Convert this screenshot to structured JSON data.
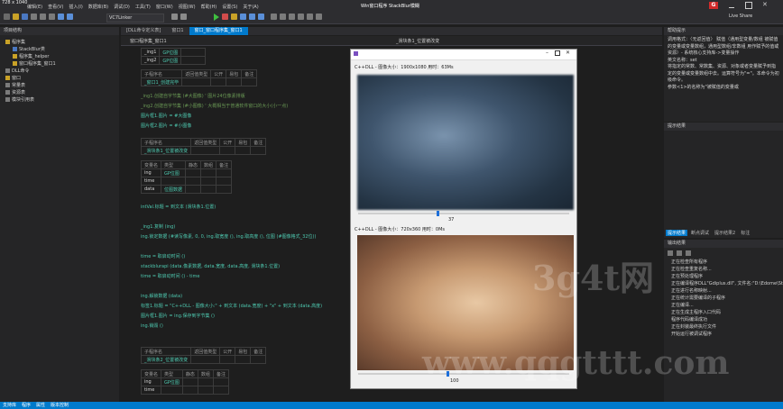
{
  "window": {
    "size_label": "728 x 1040",
    "title": "Win窗口程序 StackBlur模糊",
    "live_share": "Live Share",
    "logo_letter": "G"
  },
  "menu": [
    "编辑(E)",
    "查看(V)",
    "插入(I)",
    "数据库(B)",
    "调试(D)",
    "工具(T)",
    "窗口(W)",
    "视图(W)",
    "帮助(H)",
    "设置(S)",
    "关于(A)"
  ],
  "toolbar": {
    "target_combo": "VC7Linker"
  },
  "project_panel": {
    "title": "项目结构",
    "items": [
      "程序集",
      "StackBlur类",
      "程序集_helper",
      "窗口程序集_窗口1",
      "DLL命令",
      "窗口",
      "常量表",
      "资源表",
      "模块引用表"
    ]
  },
  "editor_tabs": [
    "[DLL命令定义表]",
    "窗口1",
    "窗口_窗口程序集_窗口1"
  ],
  "editor_breadcrumb": "窗口程序集_窗口1",
  "editor_dropdown": "_滑块条1_位置被改变",
  "var_table1": {
    "rows": [
      [
        "_ing1",
        "GP位图"
      ],
      [
        "_ing2",
        "GP位图"
      ]
    ]
  },
  "sub_table1": {
    "headers": [
      "子程序名",
      "返回值类型",
      "公开",
      "易包",
      "备注"
    ],
    "name": "_窗口1_创建完毕"
  },
  "code_block1": [
    "_ing1.创建自字节集 (#大图像)  ' 图片24位像素排版",
    "_ing2.创建自字节集 (#小图像)  ' 大概相当于普通软件窗口的大小(小一点)",
    "图片框1.图片 = #大图像",
    "图片框2.图片 = #小图像"
  ],
  "sub_table2": {
    "headers": [
      "子程序名",
      "返回值类型",
      "公开",
      "易包",
      "备注"
    ],
    "name": "_滑块条1_位置被改变"
  },
  "var_table2": {
    "headers": [
      "变量名",
      "类型",
      "静态",
      "数组",
      "备注"
    ],
    "rows": [
      [
        "ing",
        "GP位图"
      ],
      [
        "time",
        ""
      ],
      [
        "data",
        "位图数据"
      ]
    ]
  },
  "code_block2": [
    "intVal.标题 = 到文本 (滑块条1.位置)",
    "",
    "_ing1.复制 (ing)",
    "ing.锁定数据 (#读写像素, 0, 0, ing.取宽度 (), ing.取高度 (), 位图 (#图像格式_32位))",
    "",
    "time = 取启动时间 ()",
    "stackblurapi (data.像素数据, data.宽度, data.高度, 滑块条1.位置)",
    "time = 取启动时间 () - time",
    "",
    "ing.解锁数据 (data)",
    "标签1.标题 = \"C++DLL - 图像大小:\" + 到文本 (data.宽度) + \"x\" + 到文本 (data.高度)",
    "图片框1.图片 = ing.保存到字节集 ()",
    "ing.销毁 ()"
  ],
  "sub_table3": {
    "headers": [
      "子程序名",
      "返回值类型",
      "公开",
      "易包",
      "备注"
    ],
    "name": "_滑块条2_位置被改变"
  },
  "var_table3": {
    "headers": [
      "变量名",
      "类型",
      "静态",
      "数组",
      "备注"
    ],
    "rows": [
      [
        "ing",
        "GP位图"
      ],
      [
        "time",
        ""
      ]
    ]
  },
  "dialog": {
    "label1": "C++DLL - 图像大小：1900x1080   用时：63Ms",
    "slider1_value": "37",
    "slider1_position": 0.37,
    "label2": "C++DLL - 图像大小：720x360   用时：0Ms",
    "slider2_value": "100",
    "slider2_position": 0.42
  },
  "help_panel": {
    "title": "帮助提示",
    "text": "调用格式：〈无返回值〉 赋值（通用型变量/数组 被赋值的变量或变量数组，通用型数组/非数组 用作赋予的值或资源）- 系统核心支持库->变量操作\n英文名称：set\n将指定的常数、常数集、资源、对象或者变量赋予到指定的变量或变量数组中去。运算符号为\"=\"。本命令为初级命令。\n参数<1>的名称为\"被赋值的变量或"
  },
  "prompt_panel": {
    "title": "提示结果",
    "tabs": [
      "提示结果",
      "断点调试",
      "提示结果2",
      "标注"
    ]
  },
  "output_panel": {
    "title": "输出结果",
    "lines": [
      "正在检查所有程序",
      "正在检查重复名称...",
      "正在预处理程序",
      "正在编译程序DLL\"Gdiplus.dll\", 文件名:\"D:\\Edome\\StackBlur\\stackblur_DP\\Release\\Gdiplus.dll\", 版本号:\"6.3\", 创建号:\"0.0\", 作者:\"\"",
      "正在进行名称映射...",
      "正在统计需要编译的子程序",
      "正在编译...",
      "正在生成主程序入口代码",
      "程序代码编译成功",
      "正在封装最终执行文件",
      "开始运行被调试程序"
    ]
  },
  "bottom_tabs": [
    "支持库",
    "程序",
    "属性",
    "版本控制"
  ]
}
